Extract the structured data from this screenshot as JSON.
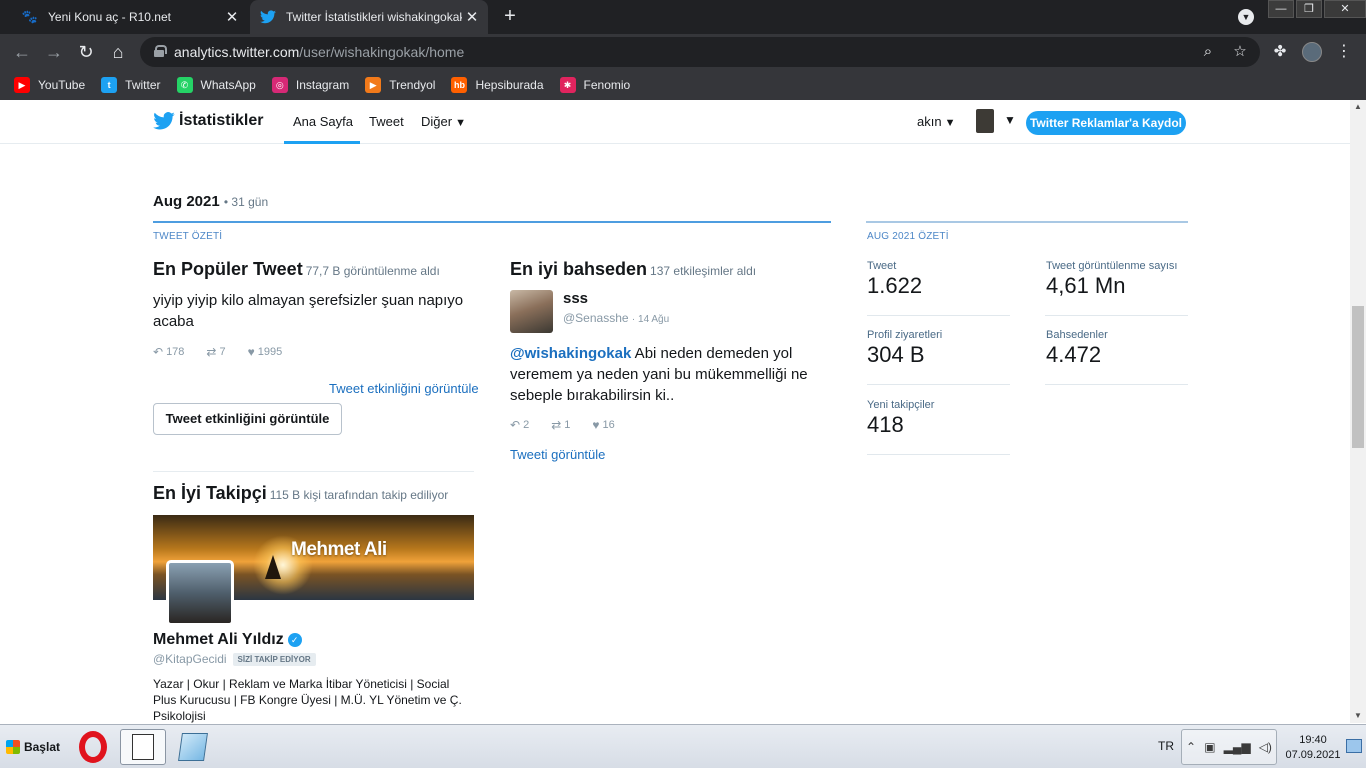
{
  "browser": {
    "tabs": [
      {
        "title": "Yeni Konu aç - R10.net",
        "active": false
      },
      {
        "title": "Twitter İstatistikleri wishakingokak |",
        "active": true
      }
    ],
    "url_host": "analytics.twitter.com",
    "url_path": "/user/wishakingokak/home",
    "bookmarks": [
      {
        "label": "YouTube",
        "color": "#ff0000",
        "glyph": "▶"
      },
      {
        "label": "Twitter",
        "color": "#1da1f2",
        "glyph": "t"
      },
      {
        "label": "WhatsApp",
        "color": "#25d366",
        "glyph": "✆"
      },
      {
        "label": "Instagram",
        "color": "#d62976",
        "glyph": "◎"
      },
      {
        "label": "Trendyol",
        "color": "#f27a1a",
        "glyph": "▶"
      },
      {
        "label": "Hepsiburada",
        "color": "#ff6000",
        "glyph": "hb"
      },
      {
        "label": "Fenomio",
        "color": "#e0245e",
        "glyph": "✱"
      }
    ]
  },
  "header": {
    "brand": "İstatistikler",
    "nav": [
      "Ana Sayfa",
      "Tweet",
      "Diğer"
    ],
    "user": "akın",
    "ads_button": "Twitter Reklamlar'a Kaydol"
  },
  "period": {
    "month": "Aug 2021",
    "days": "• 31 gün"
  },
  "tweet_summary": {
    "section_label": "TWEET ÖZETİ",
    "top_tweet": {
      "title": "En Popüler Tweet",
      "subtitle": "77,7 B görüntülenme aldı",
      "text": "yiyip yiyip kilo almayan şerefsizler şuan napıyo acaba",
      "replies": "178",
      "retweets": "7",
      "likes": "1995",
      "link": "Tweet etkinliğini görüntüle",
      "button": "Tweet etkinliğini görüntüle"
    },
    "top_mention": {
      "title": "En iyi bahseden",
      "subtitle": "137 etkileşimler aldı",
      "name": "sss",
      "handle": "@Senasshe",
      "date": "· 14 Ağu",
      "mention": "@wishakingokak",
      "text": " Abi neden demeden yol veremem ya neden yani bu mükemmelliği ne sebeple bırakabilirsin ki..",
      "replies": "2",
      "retweets": "1",
      "likes": "16",
      "link": "Tweeti görüntüle"
    },
    "top_follower": {
      "title": "En İyi Takipçi",
      "subtitle": "115 B kişi tarafından takip ediliyor",
      "banner_text": "Mehmet Ali",
      "name": "Mehmet Ali Yıldız",
      "handle": "@KitapGecidi",
      "badge": "SİZİ TAKİP EDİYOR",
      "bio": "Yazar | Okur | Reklam ve Marka İtibar Yöneticisi | Social Plus Kurucusu | FB Kongre Üyesi | M.Ü. YL Yönetim ve Ç. Psikolojisi"
    }
  },
  "month_summary": {
    "section_label": "AUG 2021 ÖZETİ",
    "metrics": [
      {
        "label": "Tweet",
        "value": "1.622"
      },
      {
        "label": "Tweet görüntülenme sayısı",
        "value": "4,61 Mn"
      },
      {
        "label": "Profil ziyaretleri",
        "value": "304 B"
      },
      {
        "label": "Bahsedenler",
        "value": "4.472"
      },
      {
        "label": "Yeni takipçiler",
        "value": "418"
      }
    ]
  },
  "taskbar": {
    "start": "Başlat",
    "lang": "TR",
    "time": "19:40",
    "date": "07.09.2021"
  },
  "colors": {
    "twitter_blue": "#1da1f2",
    "link_blue": "#1b6fbf",
    "chrome_dark": "#202124"
  }
}
